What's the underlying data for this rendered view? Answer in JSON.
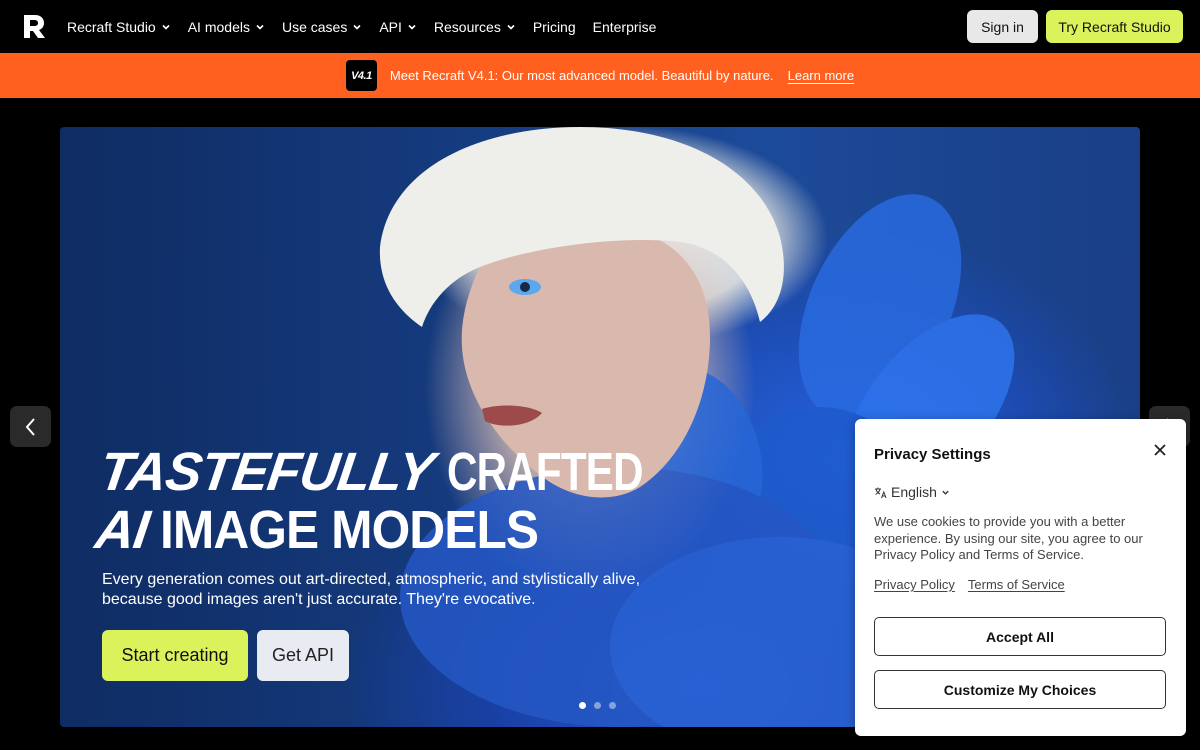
{
  "nav": {
    "logo_icon": "recraft-logo-icon",
    "items": [
      {
        "label": "Recraft Studio",
        "has_dropdown": true
      },
      {
        "label": "AI models",
        "has_dropdown": true
      },
      {
        "label": "Use cases",
        "has_dropdown": true
      },
      {
        "label": "API",
        "has_dropdown": true
      },
      {
        "label": "Resources",
        "has_dropdown": true
      },
      {
        "label": "Pricing",
        "has_dropdown": false
      },
      {
        "label": "Enterprise",
        "has_dropdown": false
      }
    ],
    "sign_in": "Sign in",
    "try_studio": "Try Recraft Studio"
  },
  "banner": {
    "badge": "V4.1",
    "text": "Meet Recraft V4.1: Our most advanced model. Beautiful by nature.",
    "link": "Learn more",
    "color": "#ff5f1f"
  },
  "hero": {
    "headline_line1_italic": "TASTEFULLY",
    "headline_line1_rest": "CRAFTED",
    "headline_line2_italic": "AI",
    "headline_line2_rest": "IMAGE MODELS",
    "subtitle": "Every generation comes out art-directed, atmospheric, and stylistically alive, because good images aren't just accurate. They're evocative.",
    "start_button": "Start creating",
    "api_button": "Get API",
    "slide_count": 3,
    "active_slide": 1,
    "accent_color": "#dcf25a"
  },
  "privacy": {
    "title": "Privacy Settings",
    "language": "English",
    "body": "We use cookies to provide you with a better experience. By using our site, you agree to our Privacy Policy and Terms of Service.",
    "privacy_policy_link": "Privacy Policy",
    "terms_link": "Terms of Service",
    "accept_all": "Accept All",
    "customize": "Customize My Choices"
  }
}
